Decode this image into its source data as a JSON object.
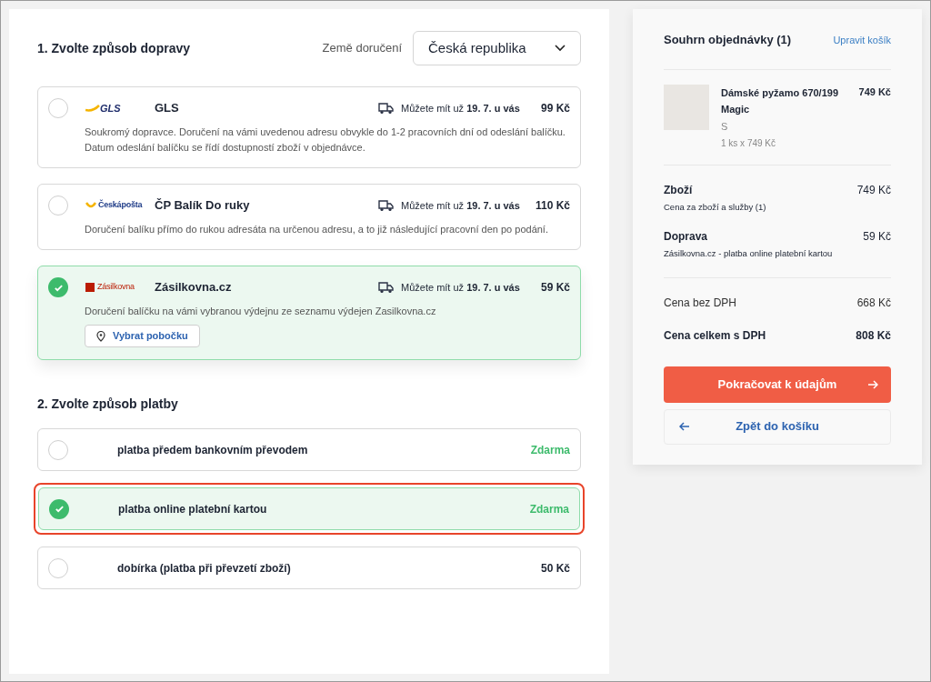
{
  "shipping": {
    "heading": "1. Zvolte způsob dopravy",
    "country_label": "Země doručení",
    "country_value": "Česká republika",
    "options": [
      {
        "kind": "gls",
        "logo_text": "GLS",
        "name": "GLS",
        "delivery": "Můžete mít už **19. 7. u vás**",
        "price": "99 Kč",
        "description": "Soukromý dopravce. Doručení na vámi uvedenou adresu obvykle do 1-2 pracovních dní od odeslání balíčku. Datum odeslání balíčku se řídí dostupností zboží v objednávce.",
        "selected": false
      },
      {
        "kind": "cp",
        "logo_text": "Českápošta",
        "name": "ČP Balík Do ruky",
        "delivery": "Můžete mít už **19. 7. u vás**",
        "price": "110 Kč",
        "description": "Doručení balíku přímo do rukou adresáta na určenou adresu, a to již následující pracovní den po podání.",
        "selected": false
      },
      {
        "kind": "zasilkovna",
        "logo_text": "Zásilkovna",
        "name": "Zásilkovna.cz",
        "delivery": "Můžete mít už **19. 7. u vás**",
        "price": "59 Kč",
        "description": "Doručení balíčku na vámi vybranou výdejnu ze seznamu výdejen Zasilkovna.cz",
        "button": "Vybrat pobočku",
        "selected": true
      }
    ]
  },
  "payment": {
    "heading": "2. Zvolte způsob platby",
    "options": [
      {
        "name": "platba předem bankovním převodem",
        "price": "Zdarma",
        "free": true,
        "selected": false,
        "annotated": false
      },
      {
        "name": "platba online platební kartou",
        "price": "Zdarma",
        "free": true,
        "selected": true,
        "annotated": true
      },
      {
        "name": "dobírka (platba při převzetí zboží)",
        "price": "50 Kč",
        "free": false,
        "selected": false,
        "annotated": false
      }
    ]
  },
  "summary": {
    "title": "Souhrn objednávky (1)",
    "edit_link": "Upravit košík",
    "item": {
      "name": "Dámské pyžamo 670/199 Magic",
      "price": "749 Kč",
      "size": "S",
      "quantity": "1 ks x 749 Kč"
    },
    "lines": [
      {
        "label": "Zboží",
        "sub": "Cena za zboží a služby (1)",
        "value": "749 Kč"
      },
      {
        "label": "Doprava",
        "sub": "Zásilkovna.cz - platba online platební kartou",
        "value": "59 Kč"
      }
    ],
    "totals": [
      {
        "label": "Cena bez DPH",
        "value": "668 Kč",
        "bold": false
      },
      {
        "label": "Cena celkem s DPH",
        "value": "808 Kč",
        "bold": true
      }
    ],
    "continue_button": "Pokračovat k údajům",
    "back_button": "Zpět do košíku"
  }
}
